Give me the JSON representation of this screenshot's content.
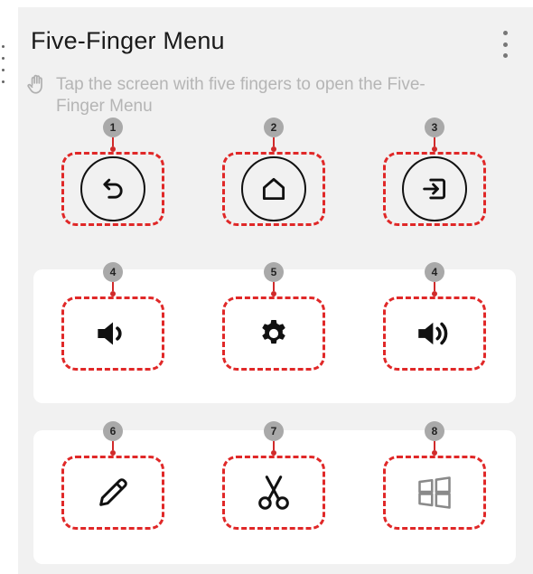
{
  "header": {
    "title": "Five-Finger Menu",
    "menu_icon": "more-vert-icon"
  },
  "hint": {
    "icon": "hand-icon",
    "text": "Tap the screen with five fingers to open the Five-Finger Menu"
  },
  "rows": [
    {
      "items": [
        {
          "badge": "1",
          "icon": "back-icon"
        },
        {
          "badge": "2",
          "icon": "home-icon"
        },
        {
          "badge": "3",
          "icon": "input-source-icon"
        }
      ]
    },
    {
      "items": [
        {
          "badge": "4",
          "icon": "volume-down-icon"
        },
        {
          "badge": "5",
          "icon": "settings-icon"
        },
        {
          "badge": "4",
          "icon": "volume-up-icon"
        }
      ]
    },
    {
      "items": [
        {
          "badge": "6",
          "icon": "pen-icon"
        },
        {
          "badge": "7",
          "icon": "scissors-icon"
        },
        {
          "badge": "8",
          "icon": "windows-icon"
        }
      ]
    }
  ],
  "colors": {
    "highlight": "#e02828",
    "badge": "#a9a9a9",
    "panel": "#f1f1f1",
    "hint_text": "#b5b5b5"
  }
}
